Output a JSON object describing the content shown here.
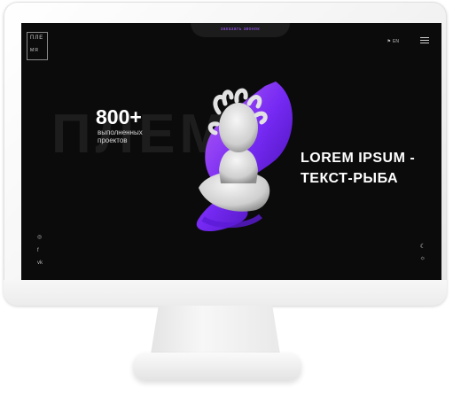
{
  "header": {
    "cta_label": "заказать звонок",
    "lang_label": "EN",
    "lang_icon": "flag-icon",
    "menu_icon": "hamburger-menu-icon"
  },
  "logo": {
    "line1": "ПЛЕ",
    "line2": "МЯ"
  },
  "background_word": "ПЛЕМЯ",
  "stats": {
    "number": "800+",
    "caption_line1": "выполненных",
    "caption_line2": "проектов"
  },
  "hero": {
    "line1": "LOREM IPSUM -",
    "line2": "ТЕКСТ-РЫБА"
  },
  "social": [
    {
      "name": "instagram-icon",
      "glyph": "◎"
    },
    {
      "name": "facebook-icon",
      "glyph": "f"
    },
    {
      "name": "vk-icon",
      "glyph": "vk"
    }
  ],
  "theme_icons": [
    {
      "name": "moon-icon",
      "glyph": "☾"
    },
    {
      "name": "sun-icon",
      "glyph": "☼"
    }
  ],
  "colors": {
    "accent": "#a259ff",
    "background": "#0b0b0b",
    "text": "#ffffff"
  }
}
